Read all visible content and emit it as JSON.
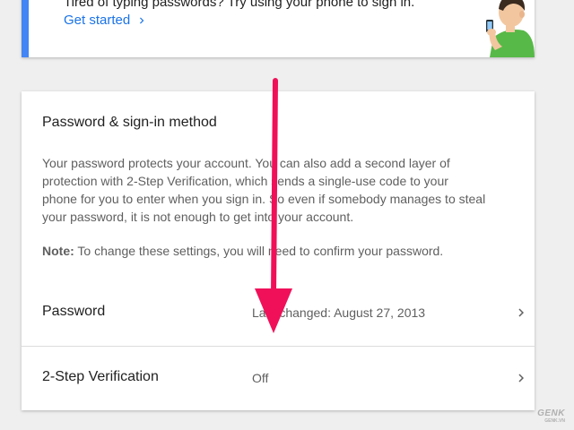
{
  "promo": {
    "text": "Tired of typing passwords? Try using your phone to sign in.",
    "link_label": "Get started",
    "accent_color": "#4285f4"
  },
  "signin_card": {
    "title": "Password & sign-in method",
    "description_lines": [
      "Your password protects your account. You can also add a second layer of",
      "protection with 2-Step Verification, which sends a single-use code to your",
      "phone for you to enter when you sign in. So even if somebody manages to steal",
      "your password, it is not enough to get into your account."
    ],
    "note_label": "Note:",
    "note_text": " To change these settings, you will need to confirm your password.",
    "rows": [
      {
        "label": "Password",
        "value": "Last changed: August 27, 2013",
        "icon": "chevron-right-icon"
      },
      {
        "label": "2-Step Verification",
        "value": "Off",
        "icon": "chevron-right-icon"
      }
    ]
  },
  "overlay": {
    "arrow_color": "#f0105a"
  },
  "watermark": {
    "brand": "GENK",
    "sub": "GENK.VN"
  }
}
